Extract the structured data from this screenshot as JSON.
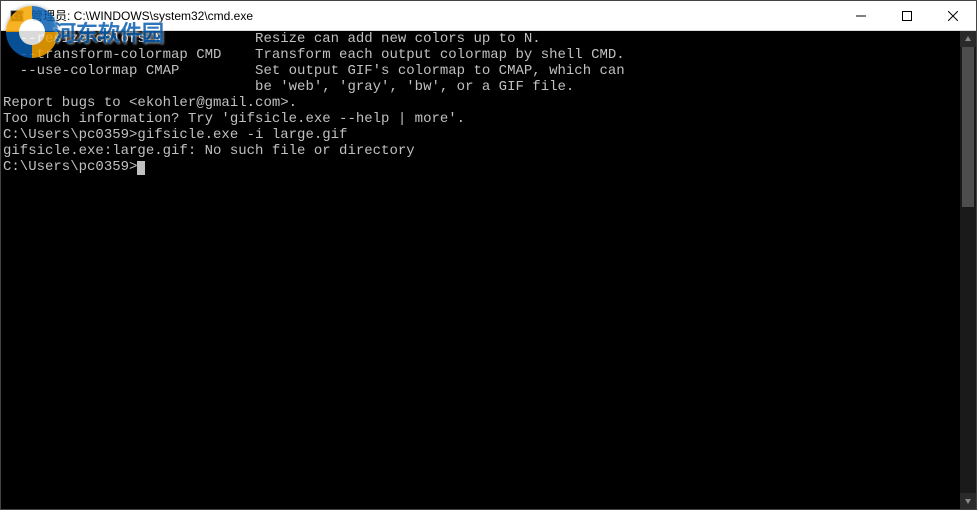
{
  "window": {
    "title": "管理员: C:\\WINDOWS\\system32\\cmd.exe"
  },
  "terminal": {
    "lines": [
      "  --resize-colors N           Resize can add new colors up to N.",
      "  --transform-colormap CMD    Transform each output colormap by shell CMD.",
      "  --use-colormap CMAP         Set output GIF's colormap to CMAP, which can",
      "                              be 'web', 'gray', 'bw', or a GIF file.",
      "",
      "Report bugs to <ekohler@gmail.com>.",
      "Too much information? Try 'gifsicle.exe --help | more'.",
      "",
      "C:\\Users\\pc0359>gifsicle.exe -i large.gif",
      "gifsicle.exe:large.gif: No such file or directory",
      "",
      "C:\\Users\\pc0359>"
    ],
    "prompt_cursor_line": 11
  },
  "watermark": {
    "text": "河东软件园"
  }
}
